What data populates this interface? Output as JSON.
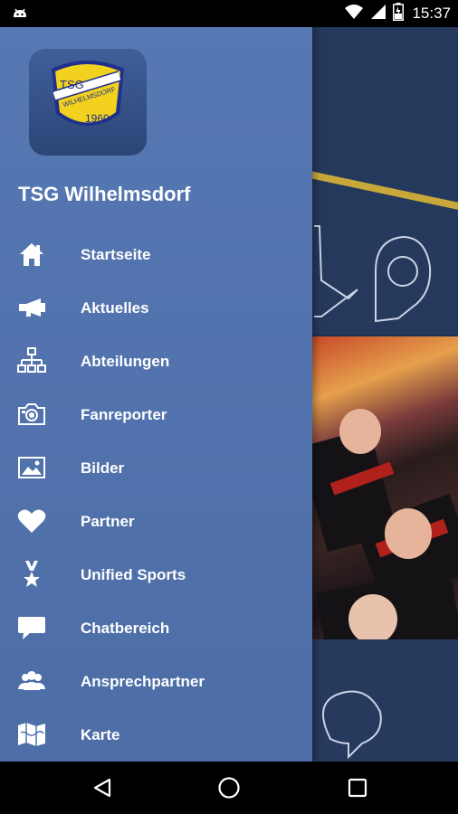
{
  "status_bar": {
    "time": "15:37"
  },
  "drawer": {
    "title": "TSG Wilhelmsdorf",
    "logo": {
      "text_top": "TSG",
      "text_middle": "WILHELMSDORF",
      "text_year": "1960"
    },
    "items": [
      {
        "label": "Startseite",
        "icon": "home-icon"
      },
      {
        "label": "Aktuelles",
        "icon": "megaphone-icon"
      },
      {
        "label": "Abteilungen",
        "icon": "org-chart-icon"
      },
      {
        "label": "Fanreporter",
        "icon": "camera-icon"
      },
      {
        "label": "Bilder",
        "icon": "image-icon"
      },
      {
        "label": "Partner",
        "icon": "heart-icon"
      },
      {
        "label": "Unified Sports",
        "icon": "medal-icon"
      },
      {
        "label": "Chatbereich",
        "icon": "chat-bubble-icon"
      },
      {
        "label": "Ansprechpartner",
        "icon": "contacts-icon"
      },
      {
        "label": "Karte",
        "icon": "map-icon"
      }
    ]
  },
  "colors": {
    "drawer_bg": "#5275b0",
    "logo_yellow": "#f3d21f",
    "text": "#ffffff"
  },
  "nav_bar": {
    "back": "back-icon",
    "home": "home-circle-icon",
    "recents": "recents-icon"
  }
}
